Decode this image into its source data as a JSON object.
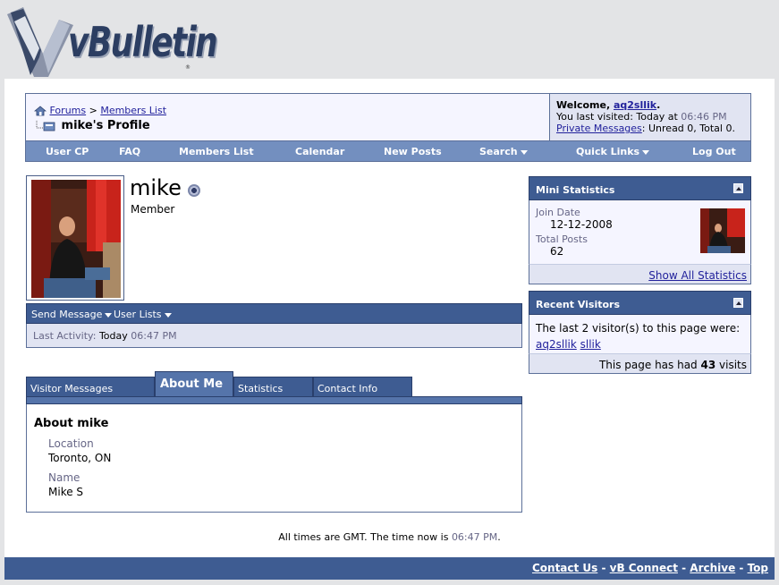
{
  "logo": {
    "text": "vBulletin",
    "mark": "®"
  },
  "breadcrumb": {
    "home": "Forums",
    "sep": ">",
    "members": "Members List"
  },
  "page_title": "mike's Profile",
  "welcome": {
    "prefix": "Welcome, ",
    "user": "aq2sllik",
    "suffix": ".",
    "visited_prefix": "You last visited: Today at ",
    "visited_time": "06:46 PM",
    "pm_link": "Private Messages",
    "pm_text": ": Unread 0, Total 0."
  },
  "navlinks": [
    "User CP",
    "FAQ",
    "Members List",
    "Calendar",
    "New Posts",
    "Search",
    "Quick Links",
    "Log Out"
  ],
  "profile": {
    "username": "mike",
    "usertitle": "Member"
  },
  "actions": {
    "send": "Send Message",
    "lists": "User Lists"
  },
  "activity": {
    "label": "Last Activity:",
    "day": "Today",
    "time": "06:47 PM"
  },
  "tabs": [
    "Visitor Messages",
    "About Me",
    "Statistics",
    "Contact Info"
  ],
  "about": {
    "title": "About mike",
    "location_label": "Location",
    "location": "Toronto, ON",
    "name_label": "Name",
    "name": "Mike S"
  },
  "mini_stats": {
    "title": "Mini Statistics",
    "join_label": "Join Date",
    "join": "12-12-2008",
    "posts_label": "Total Posts",
    "posts": "62",
    "show_all": "Show All Statistics"
  },
  "visitors": {
    "title": "Recent Visitors",
    "intro": "The last 2 visitor(s) to this page were:",
    "names": [
      "aq2sllik",
      "sllik"
    ],
    "count_prefix": "This page has had ",
    "count": "43",
    "count_suffix": " visits"
  },
  "footer": {
    "note_prefix": "All times are GMT. The time now is ",
    "note_time": "06:47 PM",
    "note_suffix": ".",
    "links": [
      "Contact Us",
      "vB Connect",
      "Archive",
      "Top"
    ],
    "sep": " - "
  },
  "colors": {
    "accent": "#3e5c92",
    "nav": "#738fbf",
    "link": "#22229c"
  }
}
